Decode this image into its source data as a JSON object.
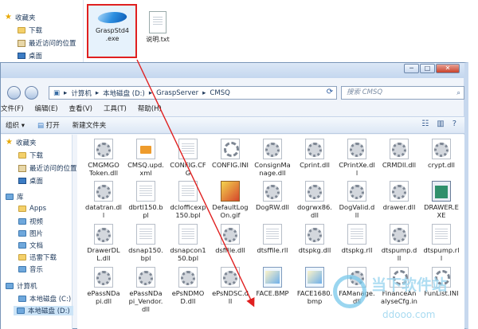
{
  "bg_window": {
    "sidebar": [
      {
        "label": "收藏夹",
        "icon": "star-icon"
      },
      {
        "label": "下载",
        "icon": "folder-icon"
      },
      {
        "label": "最近访问的位置",
        "icon": "recent-icon"
      },
      {
        "label": "桌面",
        "icon": "desktop-icon"
      }
    ],
    "files": [
      {
        "name": "GraspStd4.exe",
        "line1": "GraspStd4",
        "line2": ".exe",
        "selected": true
      },
      {
        "name": "说明.txt",
        "line1": "说明.txt",
        "line2": ""
      }
    ]
  },
  "main_window": {
    "caption_buttons": {
      "minimize": "─",
      "maximize": "□",
      "close": "✕"
    },
    "address": {
      "parts": [
        "计算机",
        "本地磁盘 (D:)",
        "GraspServer",
        "CMSQ"
      ],
      "separator": "▸"
    },
    "search_placeholder": "搜索 CMSQ",
    "menu": [
      "文件(F)",
      "编辑(E)",
      "查看(V)",
      "工具(T)",
      "帮助(H)"
    ],
    "toolbar": {
      "organize": "组织 ▾",
      "open": "打开",
      "new_folder": "新建文件夹"
    },
    "sidebar": [
      {
        "label": "收藏夹",
        "icon": "star-icon"
      },
      {
        "label": "下载",
        "icon": "folder-icon"
      },
      {
        "label": "最近访问的位置",
        "icon": "recent-icon"
      },
      {
        "label": "桌面",
        "icon": "desktop-icon"
      },
      {
        "label": "库",
        "icon": "library-icon"
      },
      {
        "label": "Apps",
        "icon": "folder-icon"
      },
      {
        "label": "视频",
        "icon": "video-icon"
      },
      {
        "label": "图片",
        "icon": "picture-icon"
      },
      {
        "label": "文档",
        "icon": "document-icon"
      },
      {
        "label": "迅雷下载",
        "icon": "download-icon"
      },
      {
        "label": "音乐",
        "icon": "music-icon"
      },
      {
        "label": "计算机",
        "icon": "computer-icon"
      },
      {
        "label": "本地磁盘 (C:)",
        "icon": "drive-icon"
      },
      {
        "label": "本地磁盘 (D:)",
        "icon": "drive-icon"
      }
    ],
    "files": [
      [
        "CMGMGO Token.dll",
        "CMSQ.upd.xml",
        "CONFIG.CFG",
        "CONFIG.INI",
        "ConsignManage.dll",
        "Cprint.dll",
        "CPrintXe.dll",
        "CRMDll.dll",
        "crypt.dll"
      ],
      [
        "datatran.dll",
        "dbrtl150.bpl",
        "dclofficexp150.bpl",
        "DefaultLogOn.gif",
        "DogRW.dll",
        "dogrwx86.dll",
        "DogValid.dll",
        "drawer.dll",
        "DRAWER.EXE"
      ],
      [
        "DrawerDLL.dll",
        "dsnap150.bpl",
        "dsnapcon150.bpl",
        "dsffile.dll",
        "dtsffile.rll",
        "dtspkg.dll",
        "dtspkg.rll",
        "dtspump.dll",
        "dtspump.rll"
      ],
      [
        "ePassNDapi.dll",
        "ePassNDapi_Vendor.dll",
        "ePsNDMOD.dll",
        "ePsNDSC.dll",
        "FACE.BMP",
        "FACE1680.bmp",
        "FAManage.dll",
        "FinanceAnalyseCfg.in",
        "FunList.INI"
      ]
    ],
    "file_types": [
      [
        "dll",
        "xml",
        "doc",
        "ini",
        "dll",
        "dll",
        "dll",
        "dll",
        "dll"
      ],
      [
        "dll",
        "doc",
        "doc",
        "gif",
        "dll",
        "dll",
        "dll",
        "dll",
        "exe"
      ],
      [
        "dll",
        "doc",
        "doc",
        "dll",
        "doc",
        "dll",
        "doc",
        "dll",
        "doc"
      ],
      [
        "dll",
        "dll",
        "dll",
        "dll",
        "bmp",
        "bmp",
        "dll",
        "ini",
        "ini"
      ]
    ]
  },
  "watermark": {
    "text": "当下软件站",
    "sub": "ddooo.com"
  }
}
